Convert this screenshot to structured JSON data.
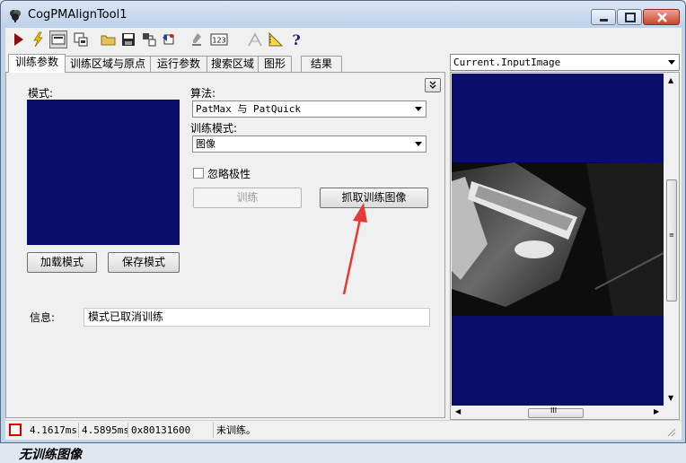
{
  "window": {
    "title": "CogPMAlignTool1",
    "controls": {
      "minimize": "minimize",
      "maximize": "maximize",
      "close": "close"
    }
  },
  "toolbar": {
    "icons": [
      "run-icon",
      "electric-icon",
      "display-toggle-icon",
      "local-display-icon",
      "open-folder-icon",
      "save-icon",
      "import-icon",
      "reset-icon",
      "clear-icon",
      "numeric-icon",
      "graphics-icon",
      "measure-icon",
      "help-icon"
    ]
  },
  "tabs": [
    {
      "label": "训练参数",
      "active": true
    },
    {
      "label": "训练区域与原点",
      "active": false
    },
    {
      "label": "运行参数",
      "active": false
    },
    {
      "label": "搜索区域",
      "active": false
    },
    {
      "label": "图形",
      "active": false
    },
    {
      "label": "结果",
      "active": false
    }
  ],
  "train_params": {
    "pattern_label": "模式:",
    "load_button": "加载模式",
    "save_button": "保存模式",
    "algorithm_label": "算法:",
    "algorithm_value": "PatMax 与 PatQuick",
    "train_mode_label": "训练模式:",
    "train_mode_value": "图像",
    "ignore_polarity_label": "忽略极性",
    "ignore_polarity_checked": false,
    "train_button": "训练",
    "grab_button": "抓取训练图像",
    "info_label": "信息:",
    "info_value": "模式已取消训练",
    "no_image_text": "无训练图像"
  },
  "display": {
    "image_select": "Current.InputImage",
    "scroll_arrows": {
      "up": "▲",
      "down": "▼",
      "left": "◀",
      "right": "▶"
    },
    "thumb_grip": "III"
  },
  "statusbar": {
    "time1": "4.1617ms",
    "time2": "4.5895ms",
    "code": "0x80131600",
    "message": "未训练。"
  },
  "colors": {
    "image_background": "#080e6a",
    "annotation_arrow": "#e53935"
  }
}
